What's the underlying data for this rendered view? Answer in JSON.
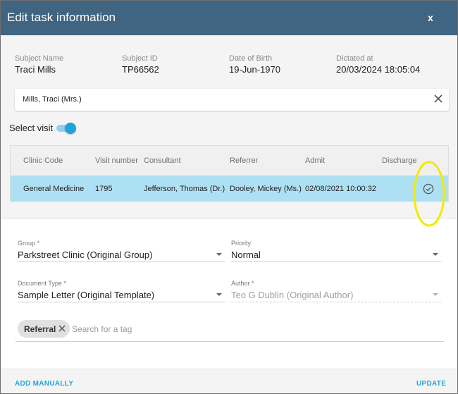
{
  "dialog": {
    "title": "Edit task information",
    "close_label": "x"
  },
  "subject": {
    "name_label": "Subject Name",
    "name": "Traci Mills",
    "id_label": "Subject ID",
    "id": "TP66562",
    "dob_label": "Date of Birth",
    "dob": "19-Jun-1970",
    "dictated_label": "Dictated at",
    "dictated": "20/03/2024 18:05:04"
  },
  "patient_select": {
    "value": "Mills, Traci  (Mrs.)"
  },
  "visit_toggle": {
    "label": "Select visit",
    "on": true
  },
  "visits_table": {
    "columns": [
      "Clinic Code",
      "Visit number",
      "Consultant",
      "Referrer",
      "Admit",
      "Discharge"
    ],
    "rows": [
      {
        "clinic": "General Medicine",
        "visit": "1795",
        "consultant": "Jefferson, Thomas (Dr.)",
        "referrer": "Dooley, Mickey (Ms.)",
        "admit": "02/08/2021 10:00:32",
        "discharge": "",
        "selected": true
      }
    ]
  },
  "form": {
    "group": {
      "label": "Group *",
      "value": "Parkstreet Clinic (Original Group)"
    },
    "priority": {
      "label": "Priority",
      "value": "Normal"
    },
    "document_type": {
      "label": "Document Type *",
      "value": "Sample Letter (Original Template)"
    },
    "author": {
      "label": "Author *",
      "value": "Teo G Dublin (Original Author)"
    }
  },
  "tags": {
    "chips": [
      "Referral"
    ],
    "placeholder": "Search for a tag"
  },
  "footer": {
    "add_manually": "ADD MANUALLY",
    "update": "UPDATE"
  },
  "colors": {
    "header": "#3f6582",
    "accent": "#23a6dc",
    "selected_row": "#aee0f4",
    "highlight_ring": "#f2ea00"
  }
}
